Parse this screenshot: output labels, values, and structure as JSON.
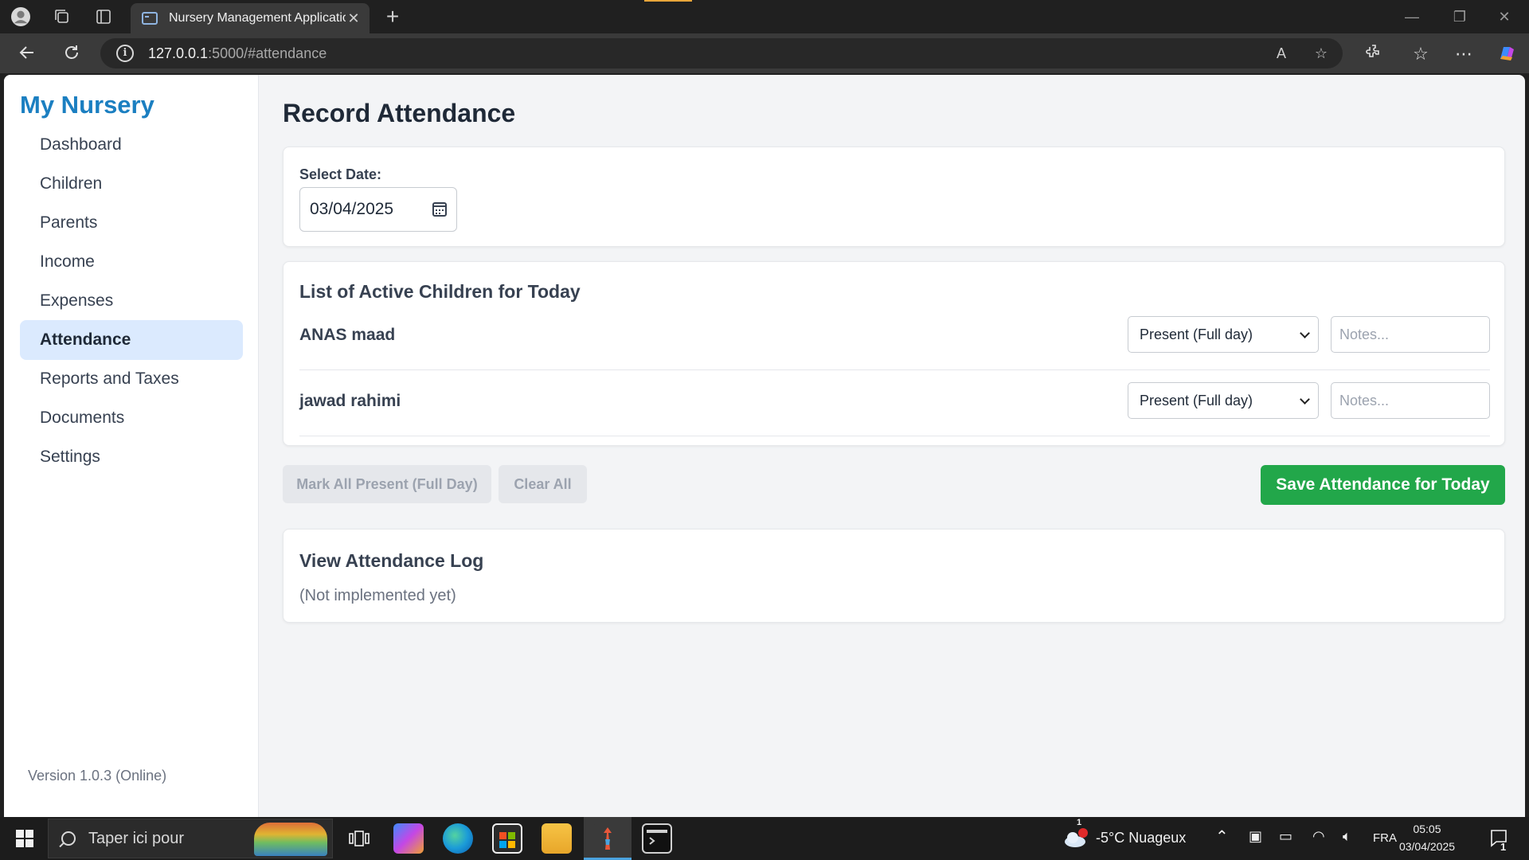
{
  "browser": {
    "tab_title": "Nursery Management Application",
    "url_host": "127.0.0.1",
    "url_path": ":5000/#attendance"
  },
  "sidebar": {
    "brand": "My Nursery",
    "items": [
      {
        "label": "Dashboard",
        "active": false
      },
      {
        "label": "Children",
        "active": false
      },
      {
        "label": "Parents",
        "active": false
      },
      {
        "label": "Income",
        "active": false
      },
      {
        "label": "Expenses",
        "active": false
      },
      {
        "label": "Attendance",
        "active": true
      },
      {
        "label": "Reports and Taxes",
        "active": false
      },
      {
        "label": "Documents",
        "active": false
      },
      {
        "label": "Settings",
        "active": false
      }
    ],
    "version": "Version 1.0.3 (Online)"
  },
  "main": {
    "title": "Record Attendance",
    "date_label": "Select Date:",
    "date_value": "03/04/2025",
    "list_title": "List of Active Children for Today",
    "children": [
      {
        "name": "ANAS maad",
        "status": "Present (Full day)",
        "notes_placeholder": "Notes..."
      },
      {
        "name": "jawad rahimi",
        "status": "Present (Full day)",
        "notes_placeholder": "Notes..."
      }
    ],
    "mark_all_label": "Mark All Present (Full Day)",
    "clear_all_label": "Clear All",
    "save_label": "Save Attendance for Today",
    "log_title": "View Attendance Log",
    "log_note": "(Not implemented yet)"
  },
  "taskbar": {
    "search_placeholder": "Taper ici pour",
    "weather": "-5°C  Nuageux",
    "weather_badge": "1",
    "language": "FRA",
    "time": "05:05",
    "date": "03/04/2025",
    "notification_count": "1"
  },
  "colors": {
    "brand": "#1b7fc1",
    "active_nav_bg": "#dbeafe",
    "save_button": "#22a74a"
  }
}
